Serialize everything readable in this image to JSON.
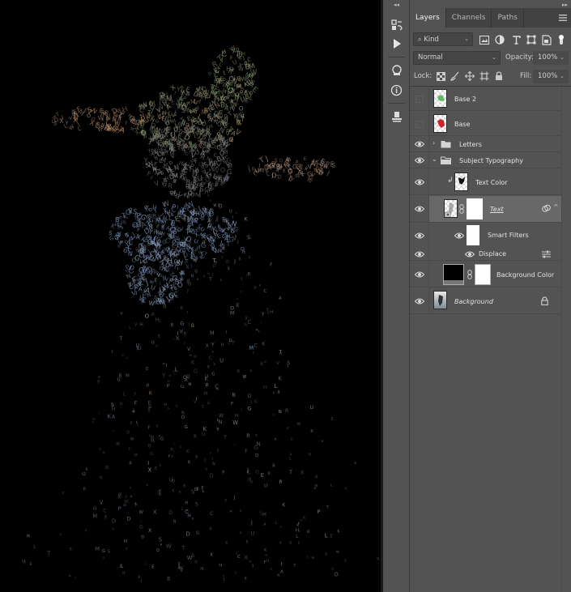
{
  "panel": {
    "tabs": [
      {
        "label": "Layers",
        "active": true
      },
      {
        "label": "Channels",
        "active": false
      },
      {
        "label": "Paths",
        "active": false
      }
    ],
    "filter": {
      "value": "Kind",
      "icon": "search-icon"
    },
    "blend_mode": "Normal",
    "opacity_label": "Opacity:",
    "opacity_value": "100%",
    "lock_label": "Lock:",
    "fill_label": "Fill:",
    "fill_value": "100%"
  },
  "layers": [
    {
      "name": "Base 2",
      "visible": false
    },
    {
      "name": "Base",
      "visible": false
    },
    {
      "name": "Letters",
      "visible": true,
      "type": "group",
      "expanded": false
    },
    {
      "name": "Subject Typography",
      "visible": true,
      "type": "group",
      "expanded": true
    },
    {
      "name": "Text Color",
      "visible": true,
      "clipped": true
    },
    {
      "name": "Text",
      "visible": true,
      "selected": true,
      "smart_object": true
    },
    {
      "name": "Smart Filters",
      "visible": true
    },
    {
      "name": "Displace",
      "visible": true
    },
    {
      "name": "Background Color",
      "visible": true
    },
    {
      "name": "Background",
      "visible": true,
      "locked": true
    }
  ],
  "colors": {
    "panel_bg": "#535353",
    "selected_row": "#686868",
    "canvas_bg": "#000000"
  }
}
